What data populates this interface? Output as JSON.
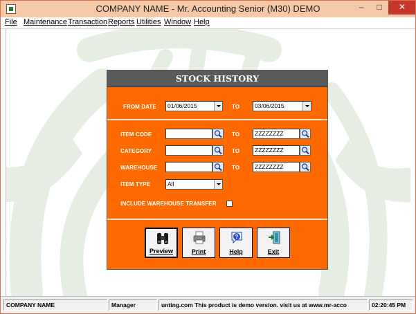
{
  "window": {
    "title": "COMPANY NAME - Mr. Accounting Senior (M30) DEMO",
    "icon": "app-icon",
    "controls": {
      "minimize": "–",
      "maximize": "□",
      "close": "✕"
    }
  },
  "menu": [
    "File",
    "Maintenance",
    "Transaction",
    "Reports",
    "Utilities",
    "Window",
    "Help"
  ],
  "dialog": {
    "title": "STOCK HISTORY",
    "from_date_label": "FROM DATE",
    "from_date": "01/06/2015",
    "to_label": "TO",
    "to_date": "03/06/2015",
    "item_code_label": "ITEM CODE",
    "item_code_from": "",
    "item_code_to": "ZZZZZZZZ",
    "category_label": "CATEGORY",
    "category_from": "",
    "category_to": "ZZZZZZZZ",
    "warehouse_label": "WAREHOUSE",
    "warehouse_from": "",
    "warehouse_to": "ZZZZZZZZ",
    "item_type_label": "ITEM TYPE",
    "item_type": "All",
    "include_transfer_label": "INCLUDE WAREHOUSE TRANSFER",
    "include_transfer_checked": false,
    "buttons": {
      "preview": "Preview",
      "print": "Print",
      "help": "Help",
      "exit": "Exit"
    }
  },
  "status": {
    "company": "COMPANY NAME",
    "user": "Manager",
    "message": "unting.com This product is demo version.  visit us at www.mr-acco",
    "time": "02:20:45 PM"
  },
  "colors": {
    "accent": "#ff6a00",
    "dialog_title": "#5a5a5a",
    "background_logo": "#e6eee3",
    "titlebar": "#f5c9a8",
    "close": "#c7362a"
  }
}
